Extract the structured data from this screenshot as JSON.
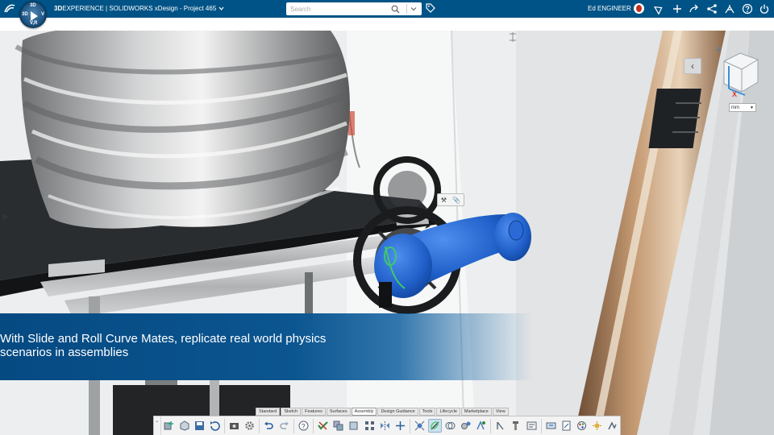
{
  "topbar": {
    "brand_3d": "3D",
    "brand_rest": "EXPERIENCE | SOLIDWORKS",
    "app_name": "xDesign - Project 465",
    "search_placeholder": "Search",
    "user_name": "Ed ENGINEER"
  },
  "compass": {
    "north": "3D",
    "west": "3D",
    "east": "V",
    "south": "V,R"
  },
  "viewport": {
    "caption": "With Slide and Roll Curve Mates, replicate real world physics scenarios in assemblies",
    "unit": "mm",
    "axis_z": "Z",
    "axis_x": "X"
  },
  "command_manager": {
    "tabs": [
      "Standard",
      "Sketch",
      "Features",
      "Surfaces",
      "Assembly",
      "Design Guidance",
      "Tools",
      "Lifecycle",
      "Marketplace",
      "View"
    ],
    "active_tab": "Assembly"
  },
  "colors": {
    "topbar": "#005386",
    "accent_blue": "#0a66c2",
    "part_blue": "#1f5fc8",
    "mate_green": "#3ec96a"
  }
}
